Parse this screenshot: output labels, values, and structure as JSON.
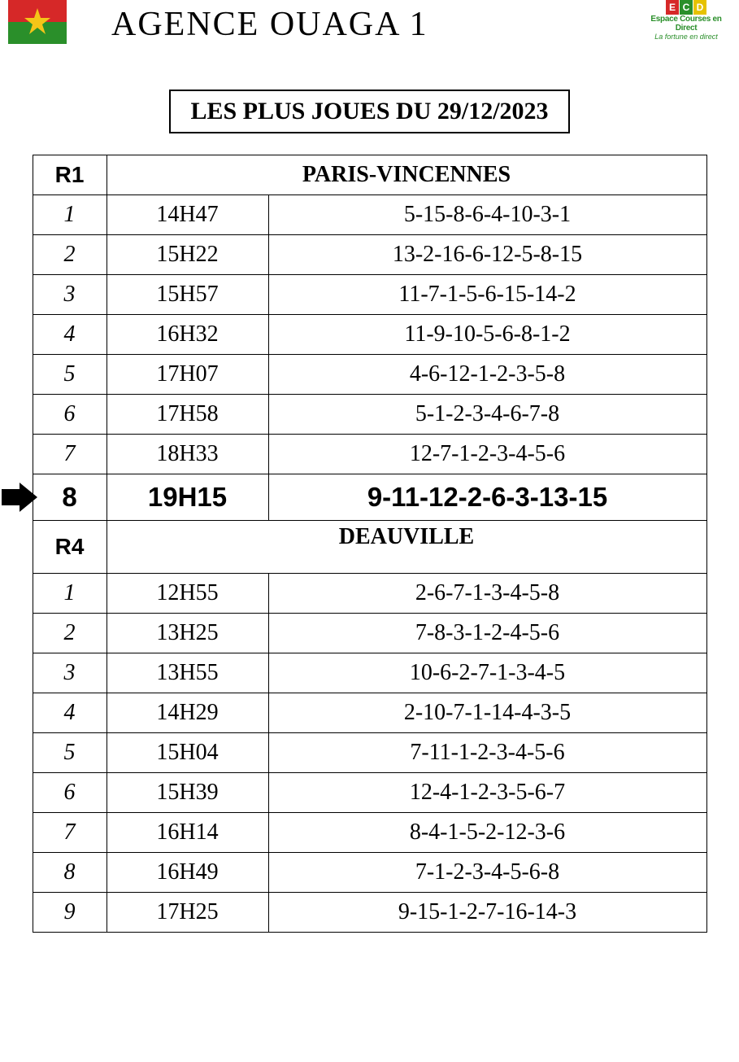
{
  "header": {
    "title": "AGENCE  OUAGA 1",
    "brand_line1": "Espace Courses en Direct",
    "brand_line2": "La fortune en direct"
  },
  "subtitle": "LES PLUS JOUES DU 29/12/2023",
  "sections": [
    {
      "code": "R1",
      "venue": "PARIS-VINCENNES",
      "rows": [
        {
          "n": "1",
          "time": "14H47",
          "picks": "5-15-8-6-4-10-3-1",
          "hl": false
        },
        {
          "n": "2",
          "time": "15H22",
          "picks": "13-2-16-6-12-5-8-15",
          "hl": false
        },
        {
          "n": "3",
          "time": "15H57",
          "picks": "11-7-1-5-6-15-14-2",
          "hl": false
        },
        {
          "n": "4",
          "time": "16H32",
          "picks": "11-9-10-5-6-8-1-2",
          "hl": false
        },
        {
          "n": "5",
          "time": "17H07",
          "picks": "4-6-12-1-2-3-5-8",
          "hl": false
        },
        {
          "n": "6",
          "time": "17H58",
          "picks": "5-1-2-3-4-6-7-8",
          "hl": false
        },
        {
          "n": "7",
          "time": "18H33",
          "picks": "12-7-1-2-3-4-5-6",
          "hl": false
        },
        {
          "n": "8",
          "time": "19H15",
          "picks": "9-11-12-2-6-3-13-15",
          "hl": true
        }
      ]
    },
    {
      "code": "R4",
      "venue": "DEAUVILLE",
      "rows": [
        {
          "n": "1",
          "time": "12H55",
          "picks": "2-6-7-1-3-4-5-8",
          "hl": false
        },
        {
          "n": "2",
          "time": "13H25",
          "picks": "7-8-3-1-2-4-5-6",
          "hl": false
        },
        {
          "n": "3",
          "time": "13H55",
          "picks": "10-6-2-7-1-3-4-5",
          "hl": false
        },
        {
          "n": "4",
          "time": "14H29",
          "picks": "2-10-7-1-14-4-3-5",
          "hl": false
        },
        {
          "n": "5",
          "time": "15H04",
          "picks": "7-11-1-2-3-4-5-6",
          "hl": false
        },
        {
          "n": "6",
          "time": "15H39",
          "picks": "12-4-1-2-3-5-6-7",
          "hl": false
        },
        {
          "n": "7",
          "time": "16H14",
          "picks": "8-4-1-5-2-12-3-6",
          "hl": false
        },
        {
          "n": "8",
          "time": "16H49",
          "picks": "7-1-2-3-4-5-6-8",
          "hl": false
        },
        {
          "n": "9",
          "time": "17H25",
          "picks": "9-15-1-2-7-16-14-3",
          "hl": false
        }
      ]
    }
  ]
}
